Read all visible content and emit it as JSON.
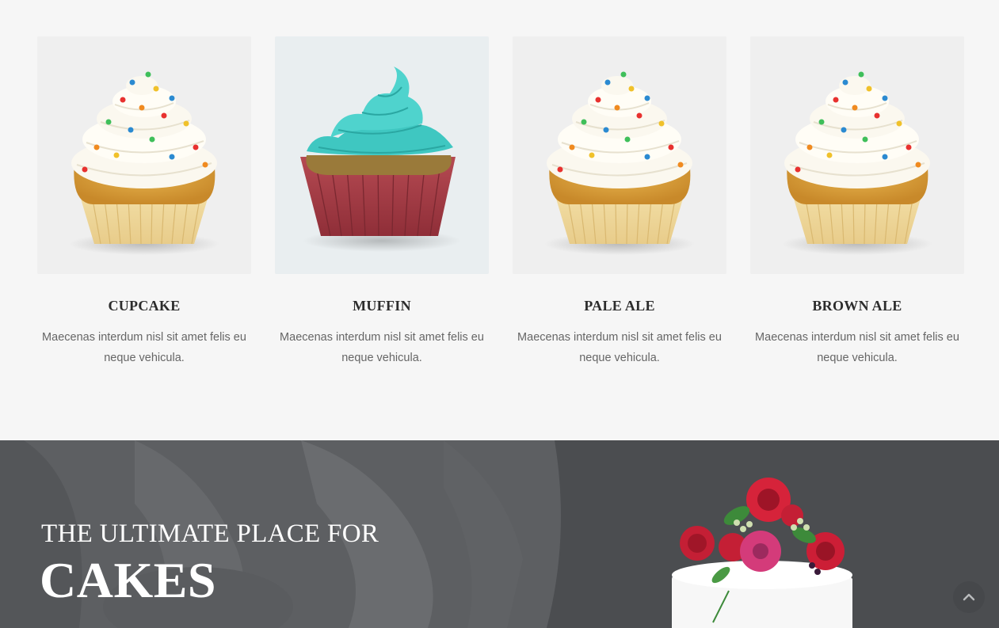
{
  "products": [
    {
      "title": "CUPCAKE",
      "description": "Maecenas interdum nisl sit amet felis eu neque vehicula.",
      "image": "cupcake-vanilla"
    },
    {
      "title": "MUFFIN",
      "description": "Maecenas interdum nisl sit amet felis eu neque vehicula.",
      "image": "cupcake-teal"
    },
    {
      "title": "PALE ALE",
      "description": "Maecenas interdum nisl sit amet felis eu neque vehicula.",
      "image": "cupcake-vanilla"
    },
    {
      "title": "BROWN ALE",
      "description": "Maecenas interdum nisl sit amet felis eu neque vehicula.",
      "image": "cupcake-vanilla"
    }
  ],
  "hero": {
    "subtitle": "THE ULTIMATE PLACE FOR",
    "title": "CAKES"
  },
  "scroll_top": {
    "icon": "chevron-up-icon"
  },
  "colors": {
    "page_bg": "#f6f6f6",
    "hero_overlay": "#4d4f52",
    "heading": "#2c2c2c",
    "body_text": "#666666"
  }
}
